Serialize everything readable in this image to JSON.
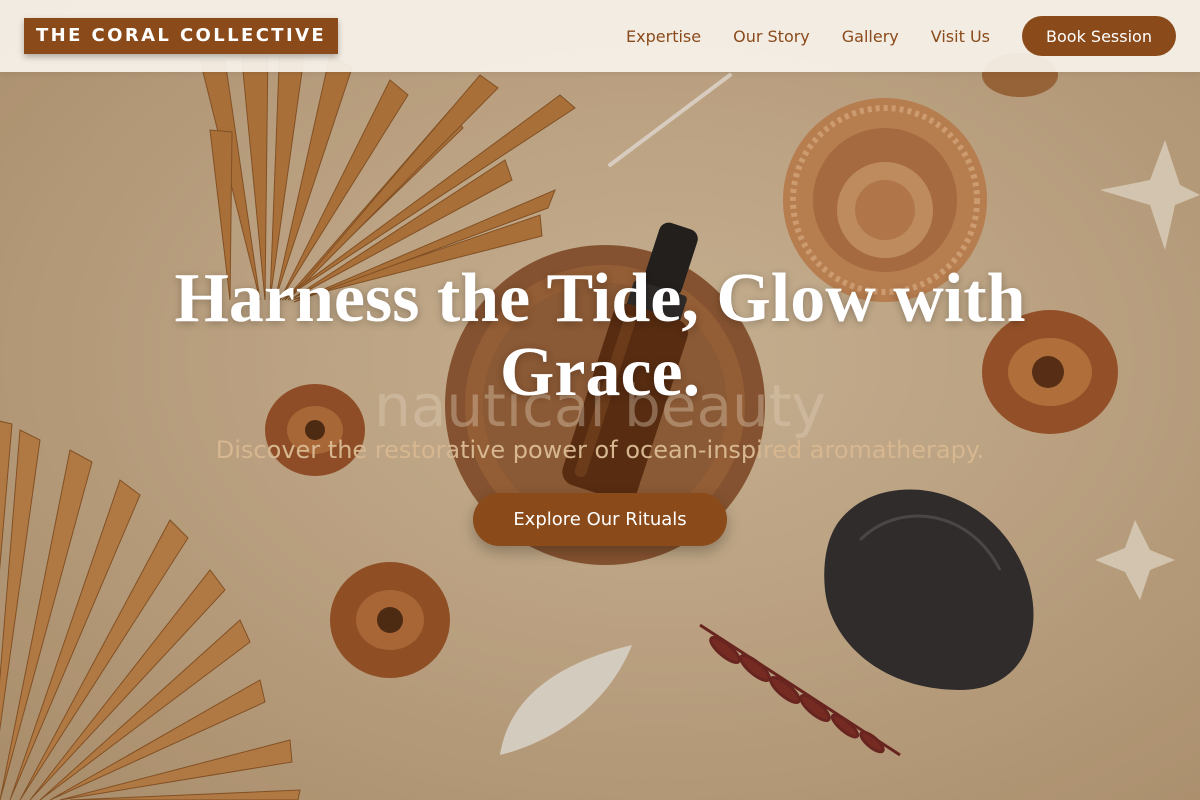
{
  "brand": {
    "name": "THE CORAL COLLECTIVE"
  },
  "nav": {
    "links": [
      "Expertise",
      "Our Story",
      "Gallery",
      "Visit Us"
    ],
    "cta_label": "Book Session"
  },
  "hero": {
    "title": "Harness the Tide, Glow with Grace.",
    "watermark": "nautical beauty",
    "subtitle": "Discover the restorative power of ocean-inspired aromatherapy.",
    "cta_label": "Explore Our Rituals"
  },
  "colors": {
    "accent": "#8a4a1a",
    "navbar_bg": "#f7f3ec",
    "hero_bg": "#cdb391",
    "subtitle": "#d7b790"
  }
}
